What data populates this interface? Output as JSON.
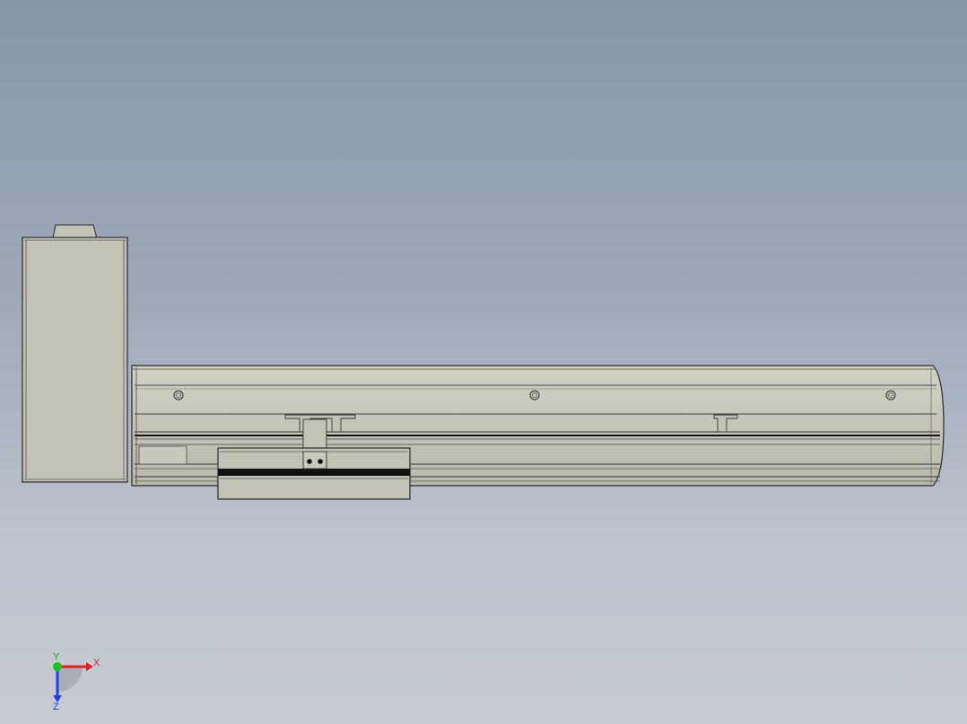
{
  "viewport": {
    "background_top": "#8796aa",
    "background_bottom": "#c7ccd3",
    "model_fill": "#c3c2b6",
    "model_edge": "#2a2a2a"
  },
  "triad": {
    "x_label": "X",
    "y_label": "Y",
    "z_label": "Z",
    "x_color": "#e02020",
    "y_color": "#20c020",
    "z_color": "#2040e0"
  }
}
